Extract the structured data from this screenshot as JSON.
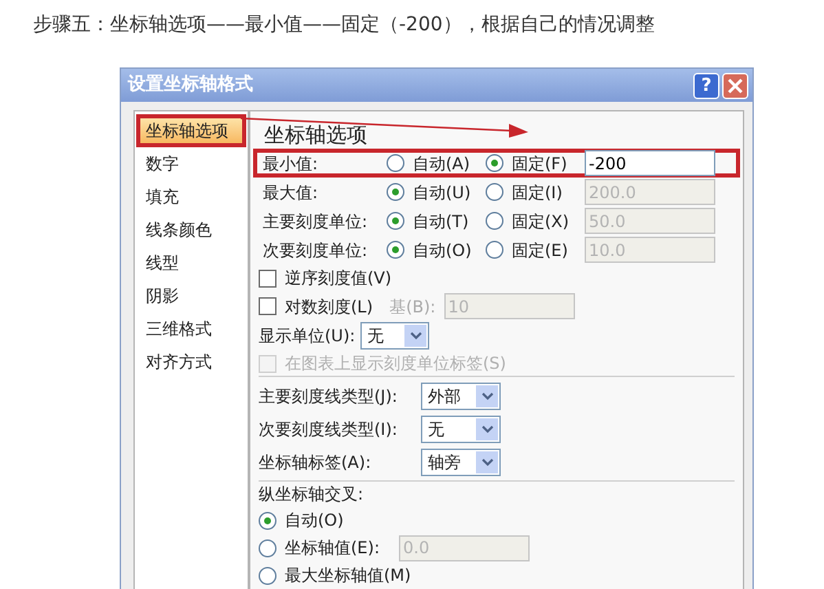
{
  "heading": "步骤五：坐标轴选项——最小值——固定（-200），根据自己的情况调整",
  "dialog": {
    "title": "设置坐标轴格式",
    "help_button": "?"
  },
  "nav": {
    "items": [
      {
        "label": "坐标轴选项",
        "selected": true
      },
      {
        "label": "数字",
        "selected": false
      },
      {
        "label": "填充",
        "selected": false
      },
      {
        "label": "线条颜色",
        "selected": false
      },
      {
        "label": "线型",
        "selected": false
      },
      {
        "label": "阴影",
        "selected": false
      },
      {
        "label": "三维格式",
        "selected": false
      },
      {
        "label": "对齐方式",
        "selected": false
      }
    ]
  },
  "section_title": "坐标轴选项",
  "value_rows": [
    {
      "label": "最小值:",
      "highlighted": true,
      "options": [
        {
          "label": "自动(A)",
          "selected": false
        },
        {
          "label": "固定(F)",
          "selected": true
        }
      ],
      "value": "-200",
      "disabled": false
    },
    {
      "label": "最大值:",
      "highlighted": false,
      "options": [
        {
          "label": "自动(U)",
          "selected": true
        },
        {
          "label": "固定(I)",
          "selected": false
        }
      ],
      "value": "200.0",
      "disabled": true
    },
    {
      "label": "主要刻度单位:",
      "highlighted": false,
      "options": [
        {
          "label": "自动(T)",
          "selected": true
        },
        {
          "label": "固定(X)",
          "selected": false
        }
      ],
      "value": "50.0",
      "disabled": true
    },
    {
      "label": "次要刻度单位:",
      "highlighted": false,
      "options": [
        {
          "label": "自动(O)",
          "selected": true
        },
        {
          "label": "固定(E)",
          "selected": false
        }
      ],
      "value": "10.0",
      "disabled": true
    }
  ],
  "reverse_checkbox": {
    "label": "逆序刻度值(V)",
    "checked": false
  },
  "log_checkbox": {
    "label": "对数刻度(L)",
    "checked": false,
    "base_label": "基(B):",
    "base_value": "10"
  },
  "display_unit": {
    "label": "显示单位(U):",
    "value": "无"
  },
  "unit_label_checkbox": {
    "label": "在图表上显示刻度单位标签(S)",
    "checked": false,
    "disabled": true
  },
  "selects": [
    {
      "label": "主要刻度线类型(J):",
      "value": "外部"
    },
    {
      "label": "次要刻度线类型(I):",
      "value": "无"
    },
    {
      "label": "坐标轴标签(A):",
      "value": "轴旁"
    }
  ],
  "crosses": {
    "title": "纵坐标轴交叉:",
    "options": [
      {
        "label": "自动(O)",
        "selected": true
      },
      {
        "label": "坐标轴值(E):",
        "selected": false,
        "value": "0.0"
      },
      {
        "label": "最大坐标轴值(M)",
        "selected": false
      }
    ]
  }
}
